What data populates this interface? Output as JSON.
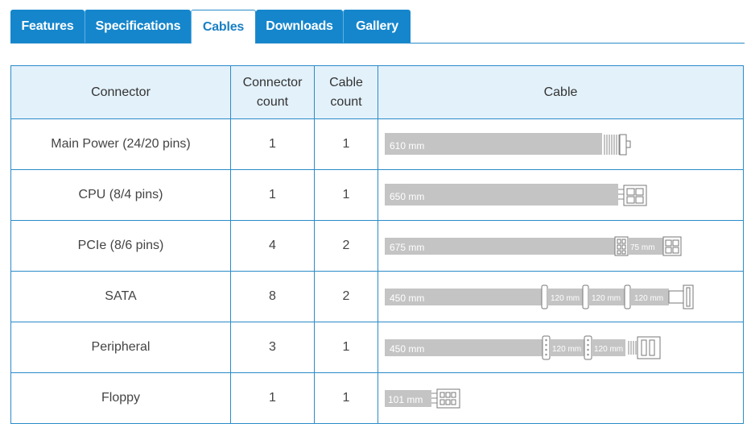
{
  "tabs": [
    {
      "label": "Features",
      "active": false
    },
    {
      "label": "Specifications",
      "active": false
    },
    {
      "label": "Cables",
      "active": true
    },
    {
      "label": "Downloads",
      "active": false
    },
    {
      "label": "Gallery",
      "active": false
    }
  ],
  "table": {
    "headers": {
      "connector": "Connector",
      "connector_count_1": "Connector",
      "connector_count_2": "count",
      "cable_count_1": "Cable",
      "cable_count_2": "count",
      "cable": "Cable"
    },
    "rows": [
      {
        "connector": "Main Power (24/20 pins)",
        "connector_count": "1",
        "cable_count": "1",
        "lengths": [
          "610 mm"
        ]
      },
      {
        "connector": "CPU (8/4 pins)",
        "connector_count": "1",
        "cable_count": "1",
        "lengths": [
          "650 mm"
        ]
      },
      {
        "connector": "PCIe (8/6 pins)",
        "connector_count": "4",
        "cable_count": "2",
        "lengths": [
          "675 mm",
          "75 mm"
        ]
      },
      {
        "connector": "SATA",
        "connector_count": "8",
        "cable_count": "2",
        "lengths": [
          "450 mm",
          "120 mm",
          "120 mm",
          "120 mm"
        ]
      },
      {
        "connector": "Peripheral",
        "connector_count": "3",
        "cable_count": "1",
        "lengths": [
          "450 mm",
          "120 mm",
          "120 mm"
        ]
      },
      {
        "connector": "Floppy",
        "connector_count": "1",
        "cable_count": "1",
        "lengths": [
          "101 mm"
        ]
      }
    ]
  },
  "colors": {
    "tab_bg": "#1586cc",
    "border": "#2a8bc9",
    "header_bg": "#e3f1fa",
    "cable_gray": "#c4c4c4"
  }
}
